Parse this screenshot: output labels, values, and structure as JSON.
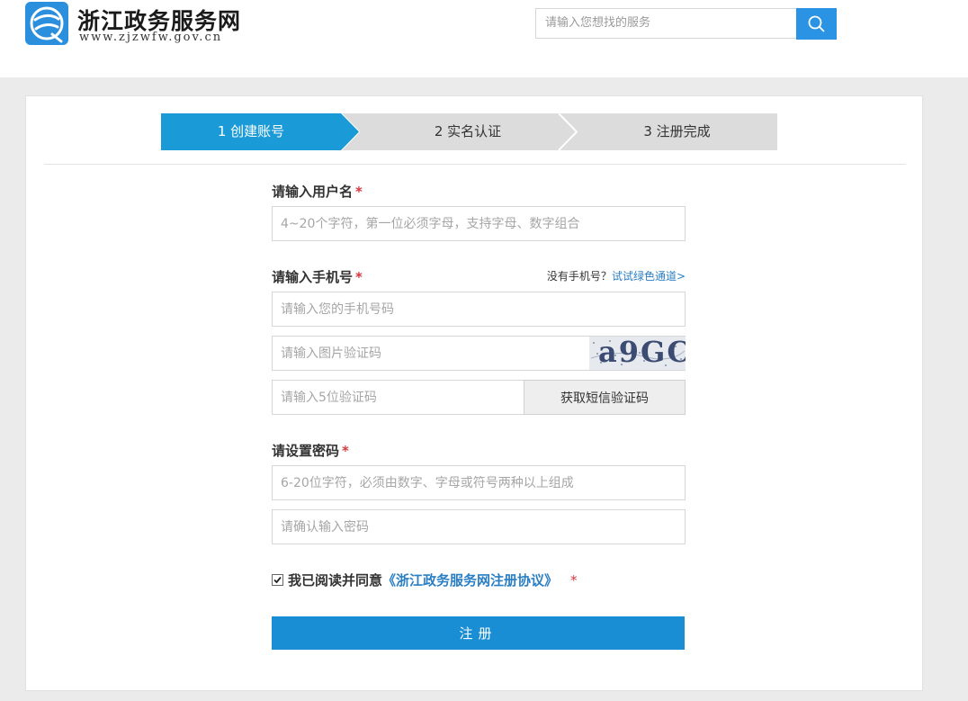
{
  "header": {
    "site_title": "浙江政务服务网",
    "site_url": "www.zjzwfw.gov.cn",
    "search_placeholder": "请输入您想找的服务"
  },
  "steps": [
    {
      "label": "1 创建账号",
      "active": true
    },
    {
      "label": "2 实名认证",
      "active": false
    },
    {
      "label": "3 注册完成",
      "active": false
    }
  ],
  "form": {
    "username_label": "请输入用户名",
    "username_placeholder": "4~20个字符，第一位必须字母，支持字母、数字组合",
    "phone_label": "请输入手机号",
    "no_phone_text": "没有手机号？",
    "no_phone_link": "试试绿色通道>",
    "phone_placeholder": "请输入您的手机号码",
    "image_code_placeholder": "请输入图片验证码",
    "captcha_text": "a9GC",
    "sms_code_placeholder": "请输入5位验证码",
    "sms_button": "获取短信验证码",
    "password_label": "请设置密码",
    "password_placeholder": "6-20位字符，必须由数字、字母或符号两种以上组成",
    "confirm_placeholder": "请确认输入密码",
    "agree_text": "我已阅读并同意",
    "agree_link": "《浙江政务服务网注册协议》",
    "required_mark": "*",
    "submit_label": "注册"
  },
  "colors": {
    "brand_blue": "#2a93e4",
    "step_active": "#1a9ad6",
    "step_inactive": "#dcdcdc",
    "required_red": "#d9373e",
    "link_blue": "#2a7fc4"
  }
}
